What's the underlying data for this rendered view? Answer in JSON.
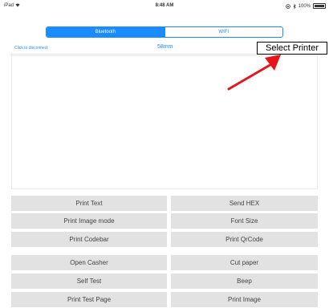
{
  "status_bar": {
    "device": "iPad",
    "time": "8:48 AM",
    "battery": "100%"
  },
  "segment": {
    "bluetooth": "Bluetooth",
    "wifi": "WIFI"
  },
  "connection": {
    "disconnect_label": "Click to disconnect",
    "paper_width": "58mm"
  },
  "annotation": {
    "label": "Select Printer"
  },
  "colors": {
    "accent": "#1a8cff",
    "button_bg": "#e2e2e2",
    "arrow": "#e8141b"
  },
  "buttons": {
    "print_text": "Print Text",
    "send_hex": "Send HEX",
    "print_image_mode": "Print Image mode",
    "font_size": "Font Size",
    "print_codebar": "Print Codebar",
    "print_qrcode": "Print QrCode",
    "open_casher": "Open Casher",
    "cut_paper": "Cut paper",
    "self_test": "Self Test",
    "beep": "Beep",
    "print_test_page": "Print Test Page",
    "print_image": "Print Image"
  }
}
